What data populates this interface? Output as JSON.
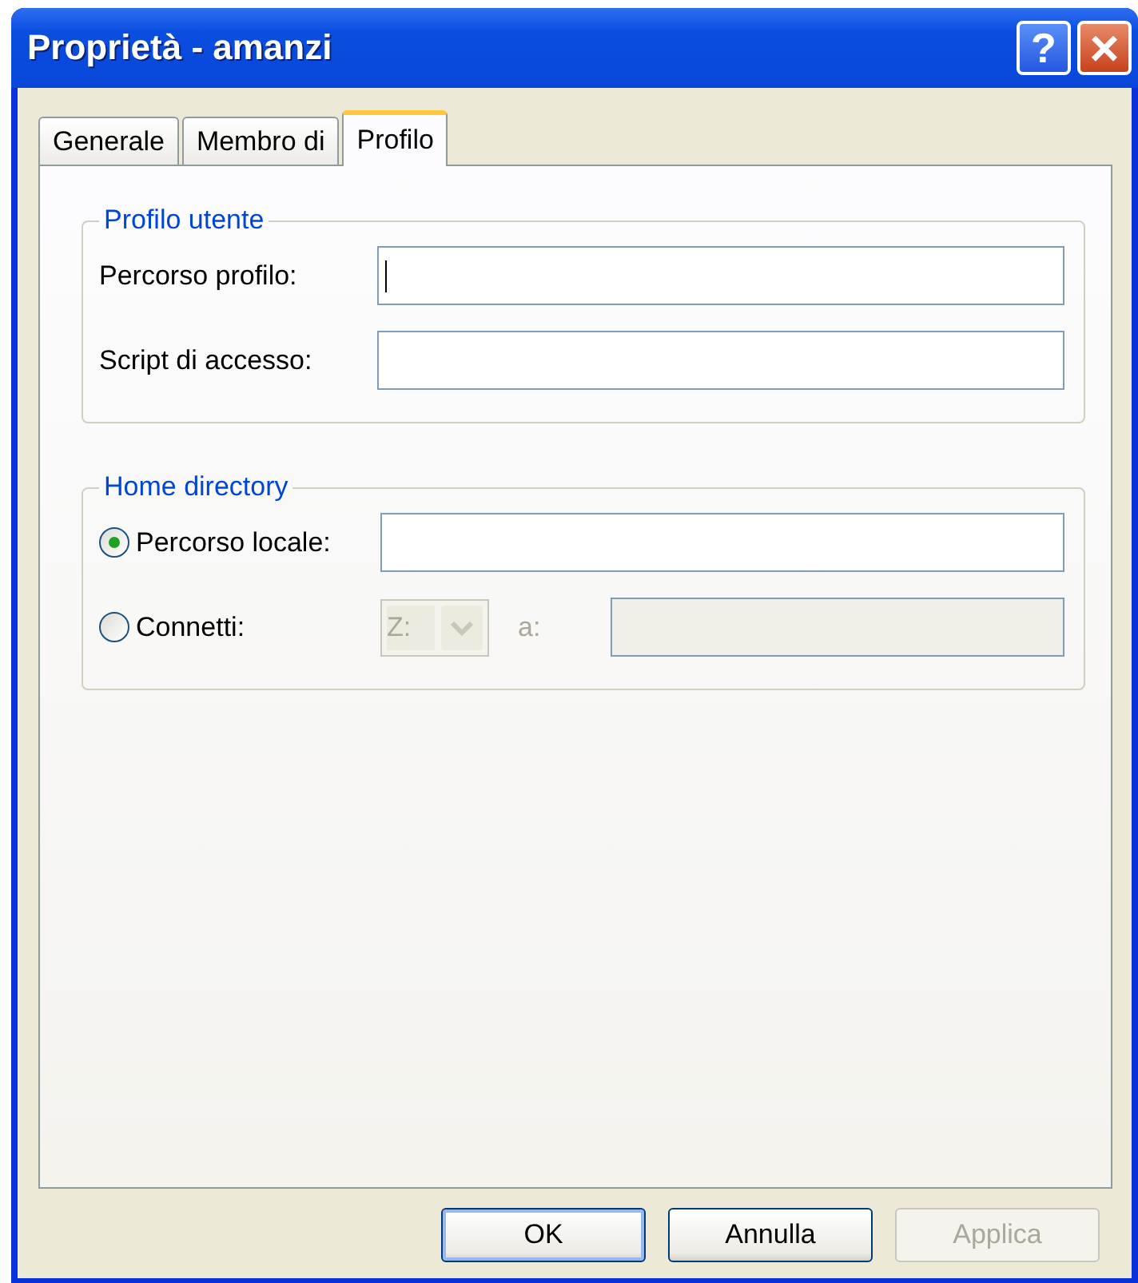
{
  "window": {
    "title": "Proprietà - amanzi",
    "controls": [
      {
        "kind": "help",
        "label": "?"
      },
      {
        "kind": "close",
        "label": "×"
      }
    ]
  },
  "tabs": [
    {
      "label": "Generale",
      "selected": false
    },
    {
      "label": "Membro di",
      "selected": false
    },
    {
      "label": "Profilo",
      "selected": true
    }
  ],
  "user_profile": {
    "title": "Profilo utente",
    "fields": [
      {
        "label": "Percorso profilo:",
        "focused": true
      },
      {
        "label": "Script di accesso:",
        "focused": false
      }
    ]
  },
  "home_directory": {
    "title": "Home directory",
    "options": [
      {
        "kind": "path",
        "label": "Percorso locale:",
        "selected": true,
        "disabled": false
      },
      {
        "kind": "drive",
        "label": "Connetti:",
        "selected": false,
        "drive": "Z:",
        "to_label": "a:",
        "disabled": true
      }
    ]
  },
  "buttons": [
    {
      "label": "OK",
      "default": true,
      "disabled": false
    },
    {
      "label": "Annulla",
      "default": false,
      "disabled": false
    },
    {
      "label": "Applica",
      "default": false,
      "disabled": true
    }
  ]
}
